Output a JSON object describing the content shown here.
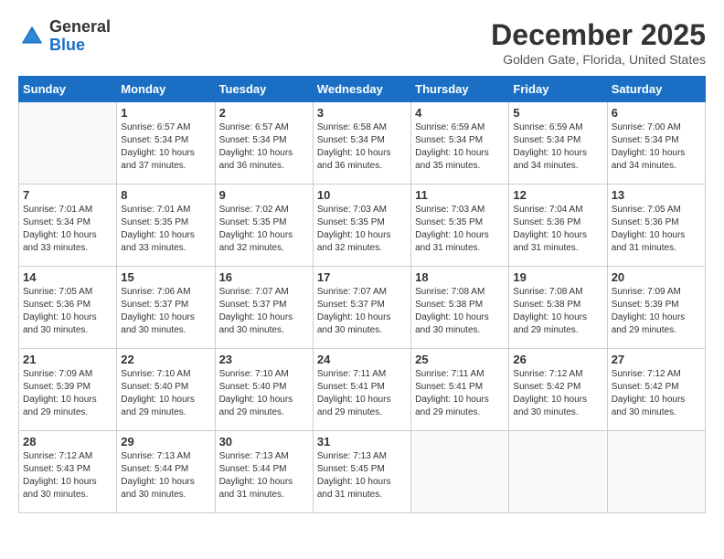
{
  "logo": {
    "general": "General",
    "blue": "Blue"
  },
  "title": "December 2025",
  "subtitle": "Golden Gate, Florida, United States",
  "days_of_week": [
    "Sunday",
    "Monday",
    "Tuesday",
    "Wednesday",
    "Thursday",
    "Friday",
    "Saturday"
  ],
  "weeks": [
    [
      {
        "day": "",
        "info": ""
      },
      {
        "day": "1",
        "info": "Sunrise: 6:57 AM\nSunset: 5:34 PM\nDaylight: 10 hours\nand 37 minutes."
      },
      {
        "day": "2",
        "info": "Sunrise: 6:57 AM\nSunset: 5:34 PM\nDaylight: 10 hours\nand 36 minutes."
      },
      {
        "day": "3",
        "info": "Sunrise: 6:58 AM\nSunset: 5:34 PM\nDaylight: 10 hours\nand 36 minutes."
      },
      {
        "day": "4",
        "info": "Sunrise: 6:59 AM\nSunset: 5:34 PM\nDaylight: 10 hours\nand 35 minutes."
      },
      {
        "day": "5",
        "info": "Sunrise: 6:59 AM\nSunset: 5:34 PM\nDaylight: 10 hours\nand 34 minutes."
      },
      {
        "day": "6",
        "info": "Sunrise: 7:00 AM\nSunset: 5:34 PM\nDaylight: 10 hours\nand 34 minutes."
      }
    ],
    [
      {
        "day": "7",
        "info": "Sunrise: 7:01 AM\nSunset: 5:34 PM\nDaylight: 10 hours\nand 33 minutes."
      },
      {
        "day": "8",
        "info": "Sunrise: 7:01 AM\nSunset: 5:35 PM\nDaylight: 10 hours\nand 33 minutes."
      },
      {
        "day": "9",
        "info": "Sunrise: 7:02 AM\nSunset: 5:35 PM\nDaylight: 10 hours\nand 32 minutes."
      },
      {
        "day": "10",
        "info": "Sunrise: 7:03 AM\nSunset: 5:35 PM\nDaylight: 10 hours\nand 32 minutes."
      },
      {
        "day": "11",
        "info": "Sunrise: 7:03 AM\nSunset: 5:35 PM\nDaylight: 10 hours\nand 31 minutes."
      },
      {
        "day": "12",
        "info": "Sunrise: 7:04 AM\nSunset: 5:36 PM\nDaylight: 10 hours\nand 31 minutes."
      },
      {
        "day": "13",
        "info": "Sunrise: 7:05 AM\nSunset: 5:36 PM\nDaylight: 10 hours\nand 31 minutes."
      }
    ],
    [
      {
        "day": "14",
        "info": "Sunrise: 7:05 AM\nSunset: 5:36 PM\nDaylight: 10 hours\nand 30 minutes."
      },
      {
        "day": "15",
        "info": "Sunrise: 7:06 AM\nSunset: 5:37 PM\nDaylight: 10 hours\nand 30 minutes."
      },
      {
        "day": "16",
        "info": "Sunrise: 7:07 AM\nSunset: 5:37 PM\nDaylight: 10 hours\nand 30 minutes."
      },
      {
        "day": "17",
        "info": "Sunrise: 7:07 AM\nSunset: 5:37 PM\nDaylight: 10 hours\nand 30 minutes."
      },
      {
        "day": "18",
        "info": "Sunrise: 7:08 AM\nSunset: 5:38 PM\nDaylight: 10 hours\nand 30 minutes."
      },
      {
        "day": "19",
        "info": "Sunrise: 7:08 AM\nSunset: 5:38 PM\nDaylight: 10 hours\nand 29 minutes."
      },
      {
        "day": "20",
        "info": "Sunrise: 7:09 AM\nSunset: 5:39 PM\nDaylight: 10 hours\nand 29 minutes."
      }
    ],
    [
      {
        "day": "21",
        "info": "Sunrise: 7:09 AM\nSunset: 5:39 PM\nDaylight: 10 hours\nand 29 minutes."
      },
      {
        "day": "22",
        "info": "Sunrise: 7:10 AM\nSunset: 5:40 PM\nDaylight: 10 hours\nand 29 minutes."
      },
      {
        "day": "23",
        "info": "Sunrise: 7:10 AM\nSunset: 5:40 PM\nDaylight: 10 hours\nand 29 minutes."
      },
      {
        "day": "24",
        "info": "Sunrise: 7:11 AM\nSunset: 5:41 PM\nDaylight: 10 hours\nand 29 minutes."
      },
      {
        "day": "25",
        "info": "Sunrise: 7:11 AM\nSunset: 5:41 PM\nDaylight: 10 hours\nand 29 minutes."
      },
      {
        "day": "26",
        "info": "Sunrise: 7:12 AM\nSunset: 5:42 PM\nDaylight: 10 hours\nand 30 minutes."
      },
      {
        "day": "27",
        "info": "Sunrise: 7:12 AM\nSunset: 5:42 PM\nDaylight: 10 hours\nand 30 minutes."
      }
    ],
    [
      {
        "day": "28",
        "info": "Sunrise: 7:12 AM\nSunset: 5:43 PM\nDaylight: 10 hours\nand 30 minutes."
      },
      {
        "day": "29",
        "info": "Sunrise: 7:13 AM\nSunset: 5:44 PM\nDaylight: 10 hours\nand 30 minutes."
      },
      {
        "day": "30",
        "info": "Sunrise: 7:13 AM\nSunset: 5:44 PM\nDaylight: 10 hours\nand 31 minutes."
      },
      {
        "day": "31",
        "info": "Sunrise: 7:13 AM\nSunset: 5:45 PM\nDaylight: 10 hours\nand 31 minutes."
      },
      {
        "day": "",
        "info": ""
      },
      {
        "day": "",
        "info": ""
      },
      {
        "day": "",
        "info": ""
      }
    ]
  ]
}
